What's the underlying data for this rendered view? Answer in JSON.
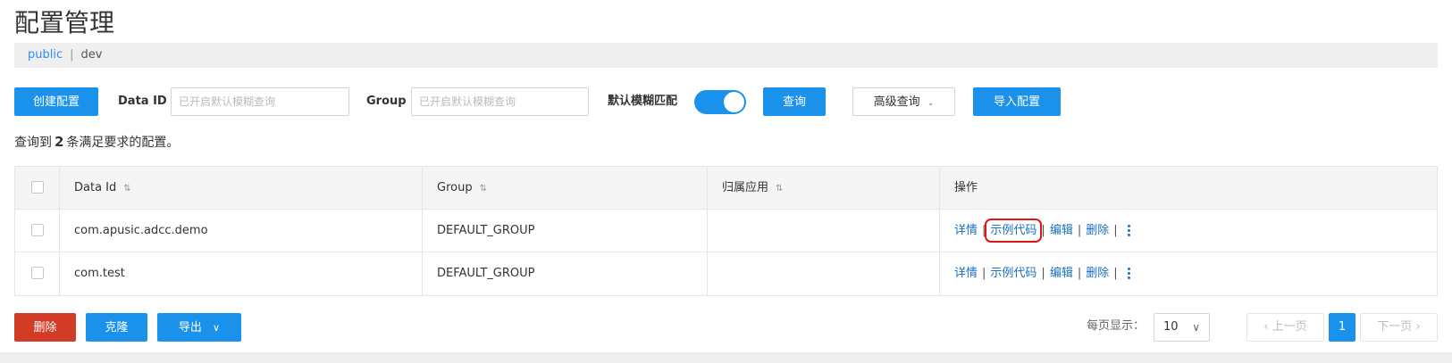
{
  "page": {
    "title": "配置管理"
  },
  "namespace": {
    "public_label": "public",
    "separator": "|",
    "dev_label": "dev"
  },
  "toolbar": {
    "create_label": "创建配置",
    "data_id_label": "Data ID",
    "data_id_placeholder": "已开启默认模糊查询",
    "group_label": "Group",
    "group_placeholder": "已开启默认模糊查询",
    "fuzzy_label": "默认模糊匹配",
    "fuzzy_on": true,
    "query_label": "查询",
    "advanced_label": "高级查询",
    "import_label": "导入配置"
  },
  "summary": {
    "prefix": "查询到",
    "count": "2",
    "suffix": "条满足要求的配置。"
  },
  "table": {
    "headers": {
      "data_id": "Data Id",
      "group": "Group",
      "app": "归属应用",
      "ops": "操作"
    },
    "rows": [
      {
        "data_id": "com.apusic.adcc.demo",
        "group": "DEFAULT_GROUP",
        "app": ""
      },
      {
        "data_id": "com.test",
        "group": "DEFAULT_GROUP",
        "app": ""
      }
    ],
    "ops": {
      "detail": "详情",
      "sample": "示例代码",
      "edit": "编辑",
      "delete": "删除",
      "sep": "|"
    }
  },
  "footer": {
    "delete_label": "删除",
    "clone_label": "克隆",
    "export_label": "导出",
    "page_size_label": "每页显示：",
    "page_size": "10",
    "prev_label": "上一页",
    "current_page": "1",
    "next_label": "下一页"
  },
  "colors": {
    "primary": "#1a91eb",
    "danger": "#d23c26",
    "link": "#1a6fc2",
    "highlight": "#e01414"
  }
}
